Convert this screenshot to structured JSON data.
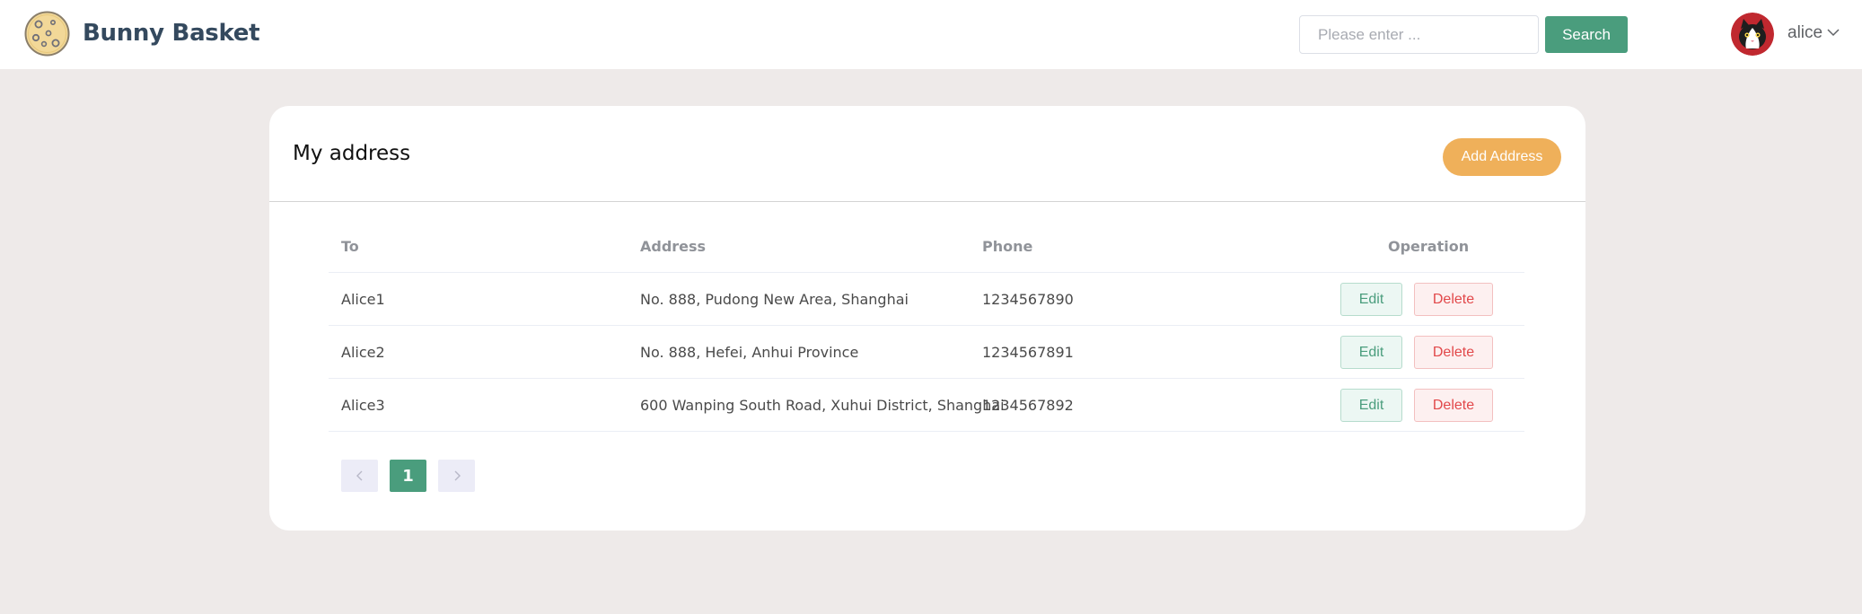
{
  "header": {
    "brand": "Bunny Basket",
    "search": {
      "placeholder": "Please enter ...",
      "value": ""
    },
    "search_label": "Search",
    "user": {
      "name": "alice"
    }
  },
  "card": {
    "title": "My address",
    "add_label": "Add Address"
  },
  "table": {
    "columns": {
      "to": "To",
      "address": "Address",
      "phone": "Phone",
      "operation": "Operation"
    },
    "rows": [
      {
        "to": "Alice1",
        "address": "No. 888, Pudong New Area, Shanghai",
        "phone": "1234567890"
      },
      {
        "to": "Alice2",
        "address": "No. 888, Hefei, Anhui Province",
        "phone": "1234567891"
      },
      {
        "to": "Alice3",
        "address": "600 Wanping South Road, Xuhui District, Shanghai",
        "phone": "1234567892"
      }
    ],
    "edit_label": "Edit",
    "delete_label": "Delete"
  },
  "pagination": {
    "current": "1"
  },
  "colors": {
    "brand_green": "#4a9d7d",
    "add_orange": "#efb05a",
    "delete_red": "#e2484a",
    "page_bg": "#eeeae9"
  },
  "icons": [
    "cookie-logo-icon",
    "cat-avatar-icon",
    "chevron-down-icon",
    "chevron-left-icon",
    "chevron-right-icon"
  ]
}
